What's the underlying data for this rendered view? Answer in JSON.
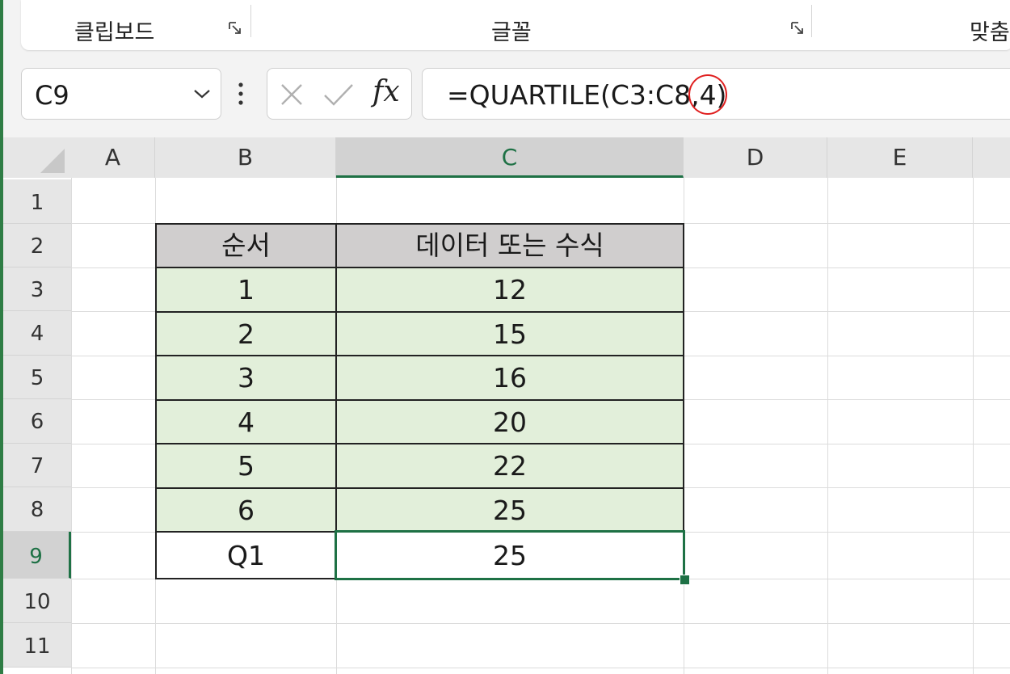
{
  "ribbon": {
    "groups": [
      {
        "label": "클립보드"
      },
      {
        "label": "글꼴"
      },
      {
        "label": "맞춤"
      }
    ]
  },
  "formula_bar": {
    "name_box": "C9",
    "formula": "=QUARTILE(C3:C8,4)",
    "fx": "fx"
  },
  "columns": [
    "A",
    "B",
    "C",
    "D",
    "E"
  ],
  "active_column": "C",
  "rows": [
    "1",
    "2",
    "3",
    "4",
    "5",
    "6",
    "7",
    "8",
    "9",
    "10",
    "11"
  ],
  "active_row": "9",
  "table": {
    "header": {
      "col_b": "순서",
      "col_c": "데이터 또는 수식"
    },
    "data": [
      {
        "b": "1",
        "c": "12"
      },
      {
        "b": "2",
        "c": "15"
      },
      {
        "b": "3",
        "c": "16"
      },
      {
        "b": "4",
        "c": "20"
      },
      {
        "b": "5",
        "c": "22"
      },
      {
        "b": "6",
        "c": "25"
      }
    ],
    "result": {
      "b": "Q1",
      "c": "25"
    }
  },
  "colors": {
    "accent_green": "#1e7145",
    "header_fill": "#d0cece",
    "data_fill": "#e2efda",
    "annotation_red": "#e02020"
  }
}
